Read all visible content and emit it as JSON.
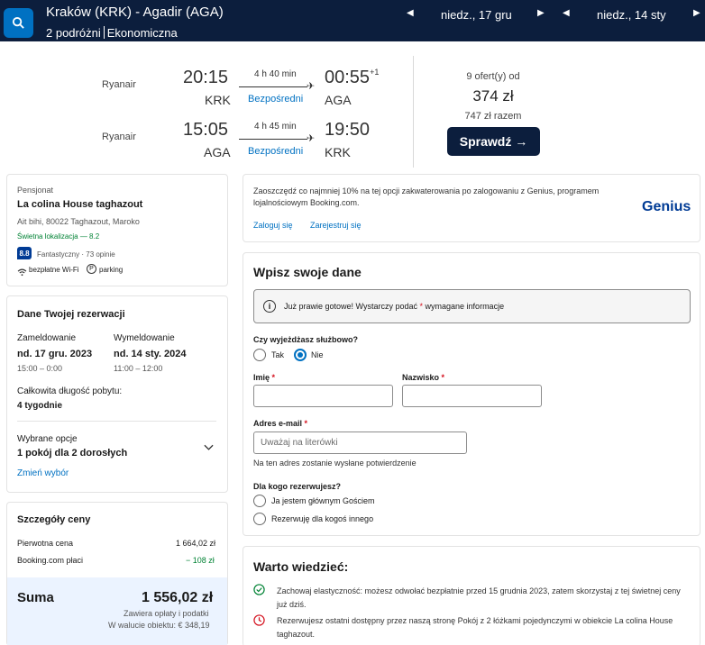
{
  "topbar": {
    "route": "Kraków (KRK) - Agadir (AGA)",
    "travellers": "2 podróżni",
    "cabin": "Ekonomiczna",
    "depart_date": "niedz., 17 gru",
    "return_date": "niedz., 14 sty"
  },
  "flight": {
    "outbound": {
      "airline": "Ryanair",
      "dep_time": "20:15",
      "dep_code": "KRK",
      "duration": "4 h 40 min",
      "stops": "Bezpośredni",
      "arr_time": "00:55",
      "day_offset": "+1",
      "arr_code": "AGA"
    },
    "inbound": {
      "airline": "Ryanair",
      "dep_time": "15:05",
      "dep_code": "AGA",
      "duration": "4 h 45 min",
      "stops": "Bezpośredni",
      "arr_time": "19:50",
      "arr_code": "KRK"
    },
    "offers": "9 ofert(y) od",
    "price": "374 zł",
    "price_total": "747 zł razem",
    "check_button": "Sprawdź →"
  },
  "property": {
    "type": "Pensjonat",
    "name": "La colina House taghazout",
    "address": "Ait bihi, 80022 Taghazout, Maroko",
    "location": "Świetna lokalizacja — 8.2",
    "score": "8.8",
    "score_text": "Fantastyczny · 73 opinie",
    "amenity_wifi": "bezpłatne Wi-Fi",
    "amenity_parking": "parking"
  },
  "reservation": {
    "title": "Dane Twojej rezerwacji",
    "checkin_label": "Zameldowanie",
    "checkin_date": "nd. 17 gru. 2023",
    "checkin_time": "15:00 – 0:00",
    "checkout_label": "Wymeldowanie",
    "checkout_date": "nd. 14 sty. 2024",
    "checkout_time": "11:00 – 12:00",
    "stay_label": "Całkowita długość pobytu:",
    "stay_value": "4 tygodnie",
    "options_label": "Wybrane opcje",
    "options_value": "1 pokój dla 2 dorosłych",
    "change_link": "Zmień wybór"
  },
  "price_details": {
    "title": "Szczegóły ceny",
    "original_label": "Pierwotna cena",
    "original_value": "1 664,02 zł",
    "discount_label": "Booking.com płaci",
    "discount_value": "− 108 zł",
    "sum_label": "Suma",
    "sum_value": "1 556,02 zł",
    "sum_note1": "Zawiera opłaty i podatki",
    "sum_note2": "W walucie obiektu: € 348,19"
  },
  "genius": {
    "text": "Zaoszczędź co najmniej 10% na tej opcji zakwaterowania po zalogowaniu z Genius, programem lojalnościowym Booking.com.",
    "login": "Zaloguj się",
    "register": "Zarejestruj się",
    "logo": "Genius"
  },
  "form": {
    "title": "Wpisz swoje dane",
    "info": "Już prawie gotowe! Wystarczy podać",
    "info_star": "*",
    "info_end": "wymagane informacje",
    "business_q": "Czy wyjeżdżasz służbowo?",
    "yes": "Tak",
    "no": "Nie",
    "first_name": "Imię",
    "last_name": "Nazwisko",
    "star": "*",
    "email_label": "Adres e-mail",
    "email_placeholder": "Uważaj na literówki",
    "email_hint": "Na ten adres zostanie wysłane potwierdzenie",
    "for_whom": "Dla kogo rezerwujesz?",
    "main_guest": "Ja jestem głównym Gościem",
    "someone_else": "Rezerwuję dla kogoś innego"
  },
  "good_to_know": {
    "title": "Warto wiedzieć:",
    "item1": "Zachowaj elastyczność: możesz odwołać bezpłatnie przed 15 grudnia 2023, zatem skorzystaj z tej świetnej ceny już dziś.",
    "item2": "Rezerwujesz ostatni dostępny przez naszą stronę Pokój z 2 łóżkami pojedynczymi w obiekcie La colina House taghazout."
  },
  "colors": {
    "navy": "#0c1e3d",
    "blue": "#0071c2",
    "green": "#008234",
    "red": "#d4111e"
  }
}
